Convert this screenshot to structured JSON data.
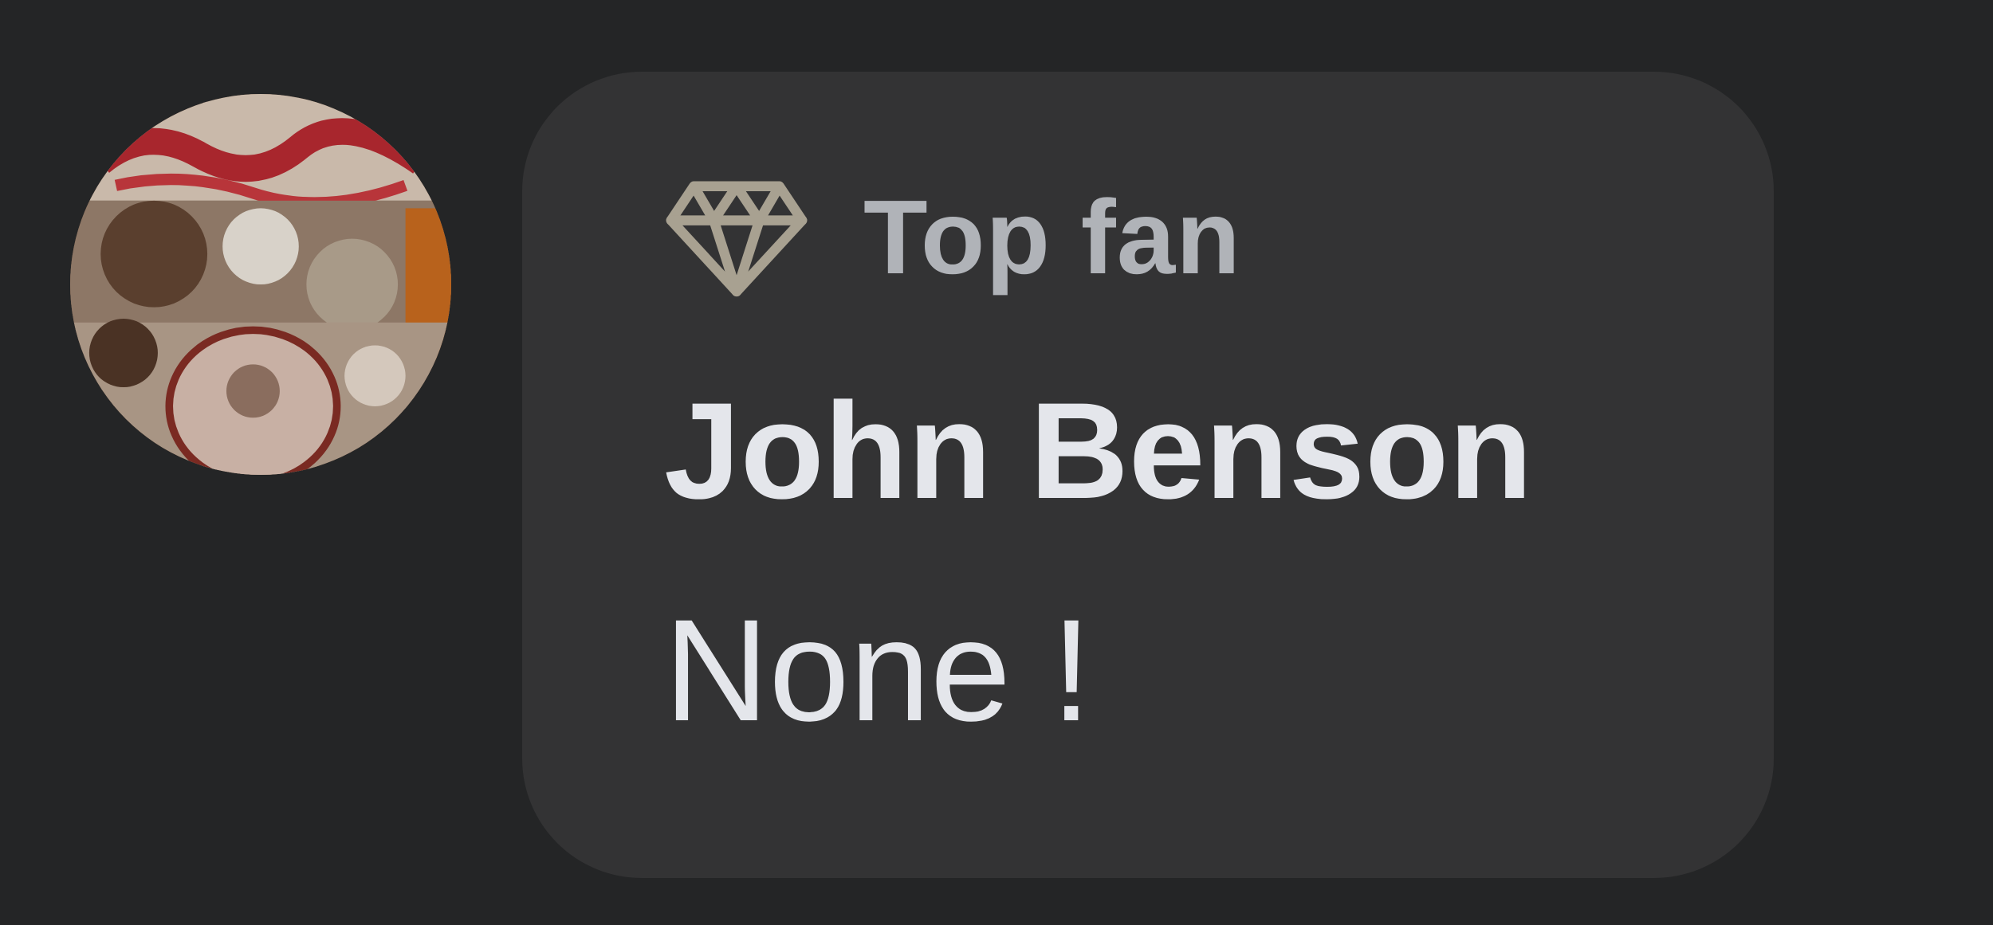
{
  "comment": {
    "avatar_icon": "user-avatar-photo",
    "badge": {
      "icon": "diamond-icon",
      "label": "Top fan",
      "color": "#a8a191"
    },
    "author_name": "John Benson",
    "text": "None !"
  },
  "colors": {
    "background": "#242526",
    "bubble": "#333334",
    "primary_text": "#e4e6eb",
    "secondary_text": "#b0b3b8"
  }
}
